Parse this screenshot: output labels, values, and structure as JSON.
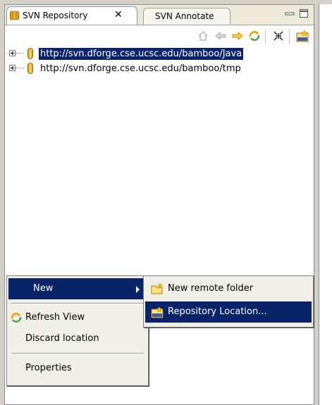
{
  "tabs": {
    "active": "SVN Repository",
    "inactive": "SVN Annotate"
  },
  "tree": {
    "items": [
      {
        "url": "http://svn.dforge.cse.ucsc.edu/bamboo/Java",
        "selected": true
      },
      {
        "url": "http://svn.dforge.cse.ucsc.edu/bamboo/tmp",
        "selected": false
      }
    ]
  },
  "toolbar": {
    "icons": [
      "home-icon",
      "back-arrow-icon",
      "forward-arrow-icon",
      "refresh-icon",
      "collapse-all-icon",
      "new-svn-repository-icon"
    ]
  },
  "context_menu": {
    "new": "New",
    "refresh_view": "Refresh View",
    "discard_location": "Discard location",
    "properties": "Properties"
  },
  "submenu": {
    "new_remote_folder": "New remote folder",
    "repository_location": "Repository Location..."
  },
  "colors": {
    "selection": "#0a246a",
    "accent_orange": "#f0a000"
  }
}
